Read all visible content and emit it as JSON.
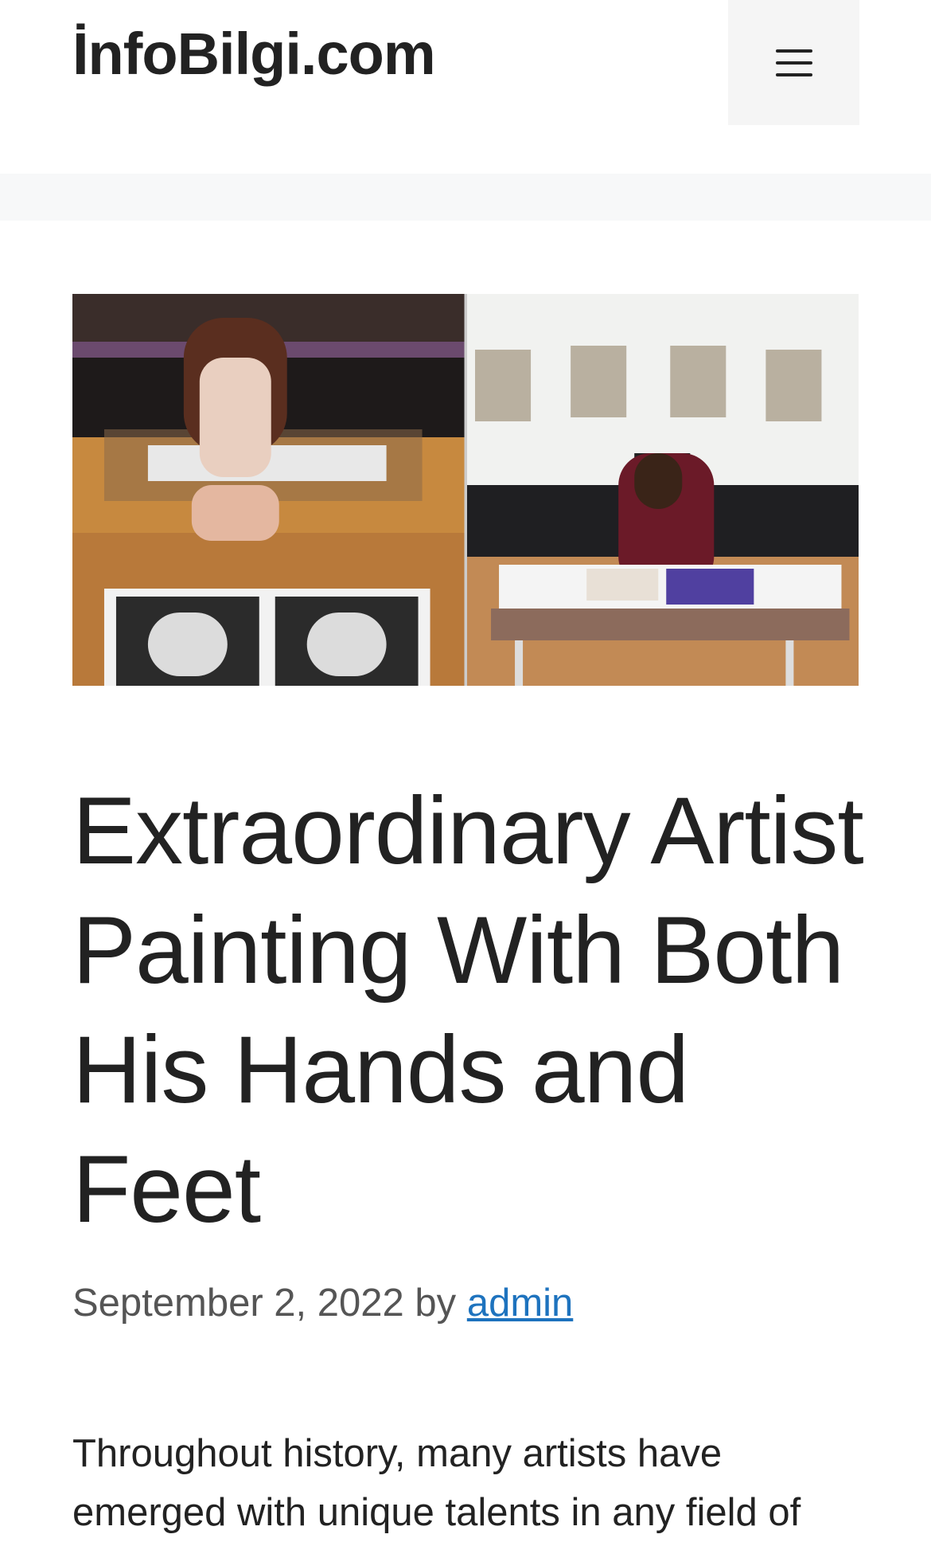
{
  "site": {
    "title": "İnfoBilgi.com"
  },
  "header": {
    "menu_icon": "hamburger-menu-icon"
  },
  "post": {
    "title": "Extraordinary Artist Painting With Both His Hands and Feet",
    "date": "September 2, 2022",
    "by": "by",
    "author": "admin",
    "excerpt": "Throughout history, many artists have emerged with unique talents in any field of"
  },
  "colors": {
    "link": "#1e73be",
    "separator": "#f7f8f9",
    "menu_bg": "#f5f5f5",
    "text": "#222222"
  }
}
